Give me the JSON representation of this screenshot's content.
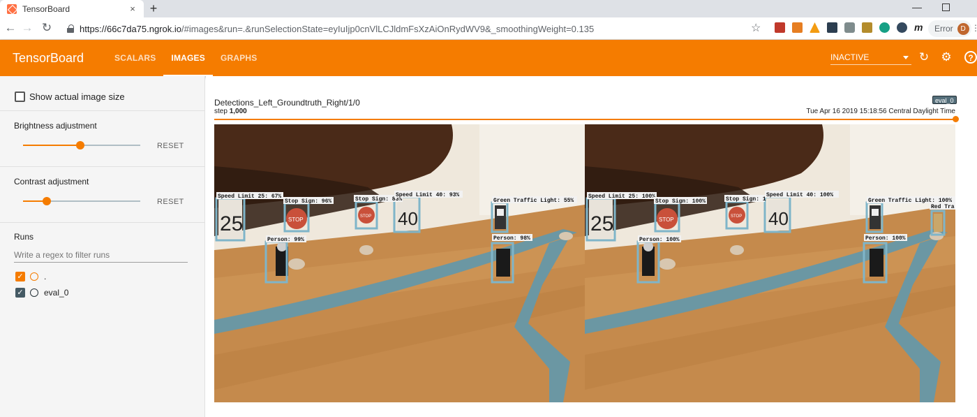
{
  "browser": {
    "tab_title": "TensorBoard",
    "tab_close": "×",
    "new_tab": "+",
    "url_host": "https://66c7da75.ngrok.io",
    "url_rest": "/#images&run=.&runSelectionState=eyIuIjp0cnVlLCJldmFsXzAiOnRydWV9&_smoothingWeight=0.135",
    "error_label": "Error",
    "avatar_initial": "D"
  },
  "header": {
    "brand": "TensorBoard",
    "tabs": [
      {
        "label": "SCALARS",
        "active": false
      },
      {
        "label": "IMAGES",
        "active": true
      },
      {
        "label": "GRAPHS",
        "active": false
      }
    ],
    "status": "INACTIVE",
    "help": "?"
  },
  "sidebar": {
    "show_actual_size_label": "Show actual image size",
    "brightness": {
      "title": "Brightness adjustment",
      "reset": "RESET",
      "value": 0.49
    },
    "contrast": {
      "title": "Contrast adjustment",
      "reset": "RESET",
      "value": 0.2
    },
    "runs_title": "Runs",
    "filter_placeholder": "Write a regex to filter runs",
    "runs": [
      {
        "name": ".",
        "checked": true,
        "color": "#f57c00"
      },
      {
        "name": "eval_0",
        "checked": true,
        "color": "#455a64"
      }
    ]
  },
  "card": {
    "tag": "Detections_Left_Groundtruth_Right/1/0",
    "step_label": "step",
    "step_value": "1,000",
    "timestamp": "Tue Apr 16 2019 15:18:56 Central Daylight Time",
    "run_badge": "eval_0"
  },
  "detections": {
    "left": [
      {
        "label": "Speed Limit 25: 67%",
        "sign": "25"
      },
      {
        "label": "Stop Sign: 96%",
        "sign": "STOP"
      },
      {
        "label": "Stop Sign: 83%",
        "sign": "STOP"
      },
      {
        "label": "Speed Limit 40: 93%",
        "sign": "40"
      },
      {
        "label": "Green Traffic Light: 55%"
      },
      {
        "label": "Person: 99%"
      },
      {
        "label": "Person: 98%"
      }
    ],
    "right": [
      {
        "label": "Speed Limit 25: 100%",
        "sign": "25"
      },
      {
        "label": "Stop Sign: 100%",
        "sign": "STOP"
      },
      {
        "label": "Stop Sign: 1",
        "sign": "STOP"
      },
      {
        "label": "Speed Limit 40: 100%",
        "sign": "40"
      },
      {
        "label": "Green Traffic Light: 100%"
      },
      {
        "label": "Red Tra"
      },
      {
        "label": "Person: 100%"
      },
      {
        "label": "Person: 100%"
      }
    ]
  },
  "colors": {
    "accent": "#f57c00",
    "sidebar_bg": "#f5f5f5",
    "box": "#7fb5c9",
    "label_bg": "#f2f2f2",
    "floor": "#c58a4c",
    "wall": "#efe8dc",
    "lane": "#6b97a3"
  }
}
